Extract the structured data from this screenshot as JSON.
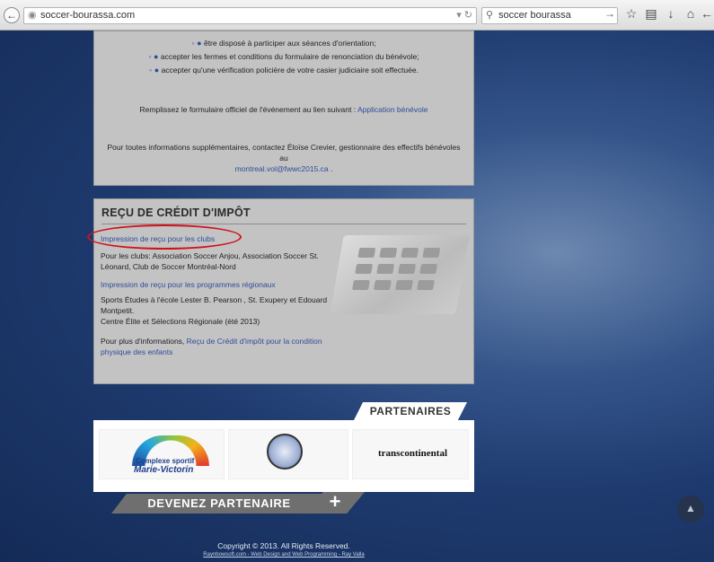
{
  "browser": {
    "url": "soccer-bourassa.com",
    "search_value": "soccer bourassa"
  },
  "volunteer": {
    "bullets": [
      "être disposé à participer aux séances d'orientation;",
      "accepter les fermes et conditions du formulaire de renonciation du bénévole;",
      "accepter qu'une vérification policière de votre casier judiciaire soit effectuée."
    ],
    "fill_text": "Remplissez le formulaire officiel de l'événement au lien suivant :",
    "fill_link": "Application bénévole",
    "contact_text": "Pour toutes informations supplémentaires, contactez Éloïse Crevier, gestionnaire des effectifs bénévoles au",
    "contact_email": "montreal.vol@fwwc2015.ca",
    "contact_end": "."
  },
  "tax": {
    "title": "REÇU DE CRÉDIT D'IMPÔT",
    "clubs_link": "Impression de reçu pour les clubs",
    "clubs_text": "Pour les clubs: Association Soccer Anjou, Association Soccer St. Léonard, Club de Soccer Montréal-Nord",
    "regional_link": "Impression de reçu pour les programmes régionaux",
    "regional_text_1": "Sports Études à l'école Lester B. Pearson , St. Exupery et Edouard Montpetit.",
    "regional_text_2": "Centre Élite et Sélections Régionale (été 2013)",
    "more_text": "Pour plus d'informations,",
    "more_link": "Reçu de Crédit d'impôt pour la condition physique des enfants"
  },
  "partners": {
    "tab": "PARTENAIRES",
    "logos": [
      "Complexe sportif",
      "Marie-Victorin",
      "transcontinental"
    ],
    "become": "DEVENEZ PARTENAIRE",
    "plus": "+"
  },
  "footer": {
    "copyright": "Copyright © 2013. All Rights Reserved.",
    "credit": "Raynbowsoft.com - Web Design and Web Programming - Ray Valla"
  }
}
